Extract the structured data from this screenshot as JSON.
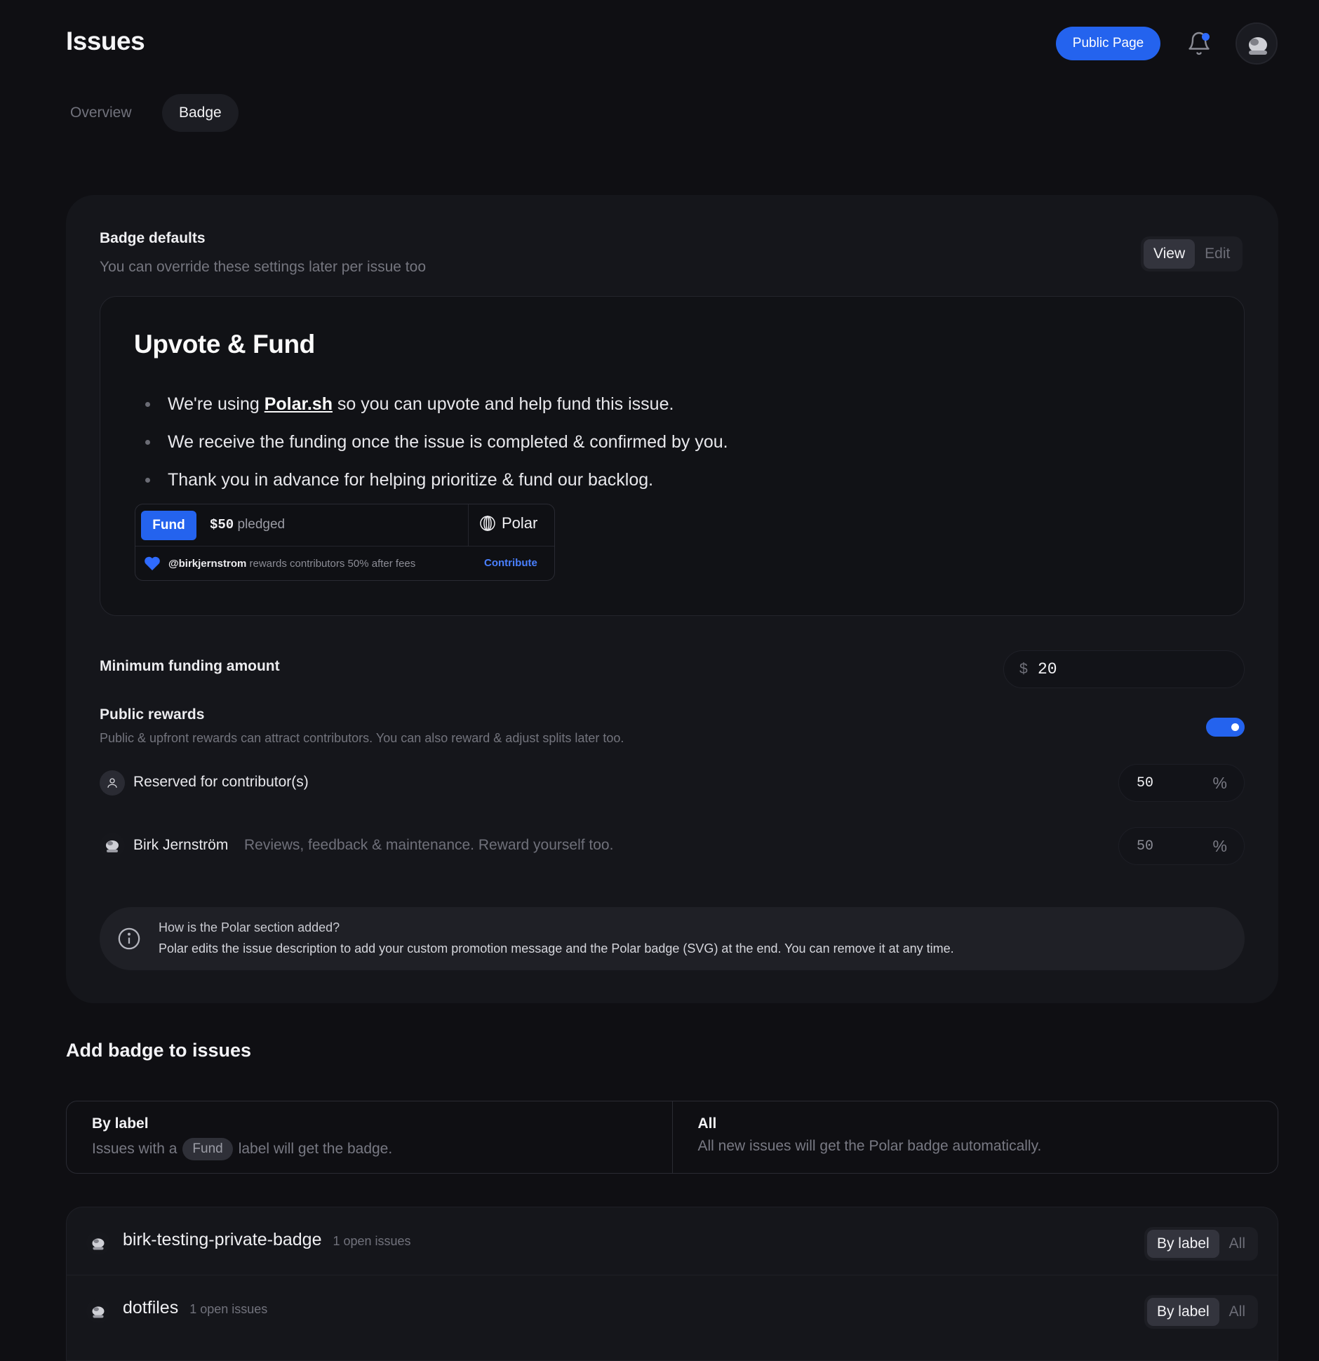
{
  "header": {
    "title": "Issues",
    "public_page_label": "Public Page"
  },
  "tabs": [
    {
      "label": "Overview",
      "active": false
    },
    {
      "label": "Badge",
      "active": true
    }
  ],
  "badge_defaults": {
    "title": "Badge defaults",
    "subtitle": "You can override these settings later per issue too",
    "mode_toggle": {
      "view": "View",
      "edit": "Edit",
      "selected": "View"
    },
    "preview": {
      "heading": "Upvote & Fund",
      "bullet_1_prefix": "We're using ",
      "bullet_1_link": "Polar.sh",
      "bullet_1_suffix": " so you can upvote and help fund this issue.",
      "bullet_2": "We receive the funding once the issue is completed & confirmed by you.",
      "bullet_3": "Thank you in advance for helping prioritize & fund our backlog.",
      "widget": {
        "fund_label": "Fund",
        "pledged_amount": "$50",
        "pledged_suffix": " pledged",
        "brand": "Polar",
        "rewards_user": "@birkjernstrom",
        "rewards_text": " rewards contributors 50% after fees",
        "contribute_label": "Contribute"
      }
    },
    "minimum_funding": {
      "label": "Minimum funding amount",
      "currency": "$",
      "value": "20"
    },
    "public_rewards": {
      "label": "Public rewards",
      "description": "Public & upfront rewards can attract contributors. You can also reward & adjust splits later too.",
      "enabled": true,
      "contributors": {
        "label": "Reserved for contributor(s)",
        "percent": "50",
        "suffix": "%"
      },
      "maintainer": {
        "name": "Birk Jernström",
        "description": "Reviews, feedback & maintenance. Reward yourself too.",
        "percent": "50",
        "suffix": "%"
      }
    },
    "info": {
      "title": "How is the Polar section added?",
      "body": "Polar edits the issue description to add your custom promotion message and the Polar badge (SVG) at the end. You can remove it at any time."
    }
  },
  "add_badge": {
    "title": "Add badge to issues",
    "by_label": {
      "title": "By label",
      "desc_prefix": "Issues with a",
      "pill": "Fund",
      "desc_suffix": "label will get the badge."
    },
    "all": {
      "title": "All",
      "desc": "All new issues will get the Polar badge automatically."
    },
    "repos": [
      {
        "name": "birk-testing-private-badge",
        "count": "1 open issues",
        "by_label": "By label",
        "all": "All",
        "selected": "By label"
      },
      {
        "name": "dotfiles",
        "count": "1 open issues",
        "by_label": "By label",
        "all": "All",
        "selected": "By label"
      }
    ]
  },
  "colors": {
    "accent": "#2463ee",
    "background": "#0f0f13",
    "card": "#15161b",
    "link": "#4a80ff"
  },
  "icons": [
    "bell-icon",
    "avatar",
    "user-icon",
    "info-icon",
    "heart-icon",
    "polar-logo-icon"
  ]
}
